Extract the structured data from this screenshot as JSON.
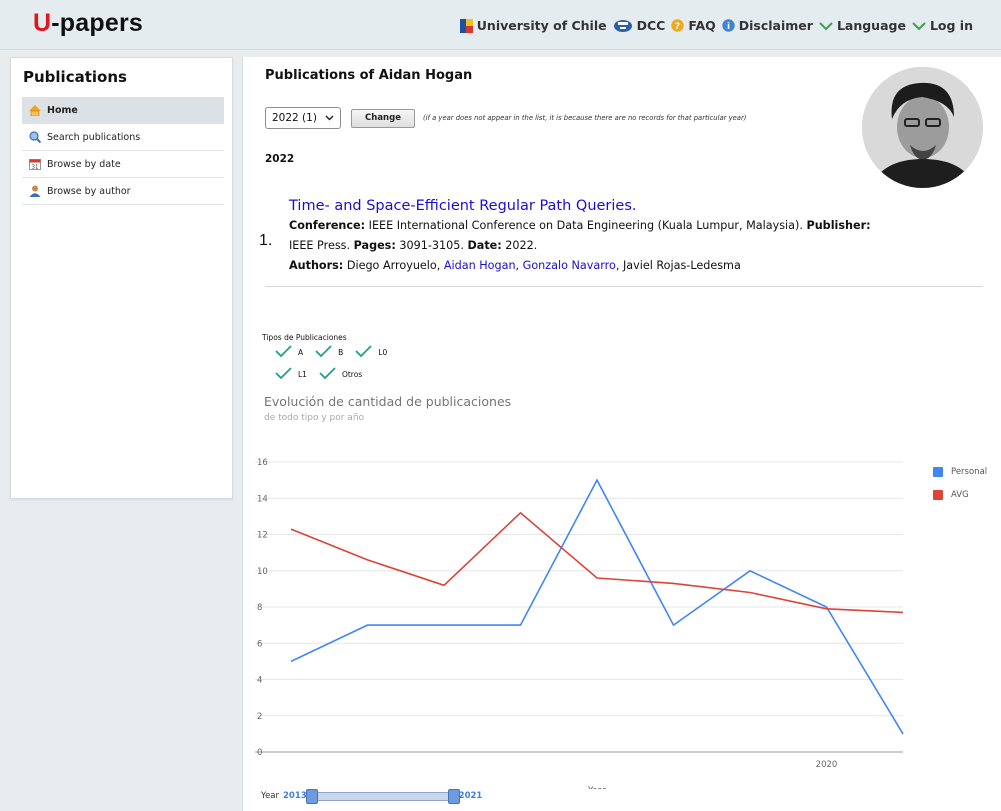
{
  "header": {
    "logo_u": "U",
    "logo_rest": "-papers",
    "nav": [
      {
        "label": "University of Chile",
        "icon": "university-icon"
      },
      {
        "label": "DCC",
        "icon": "dcc-icon"
      },
      {
        "label": "FAQ",
        "icon": "faq-icon"
      },
      {
        "label": "Disclaimer",
        "icon": "info-icon"
      },
      {
        "label": "Language",
        "icon": "chevron-down-icon"
      },
      {
        "label": "Log in",
        "icon": "chevron-down-icon"
      }
    ]
  },
  "sidebar": {
    "title": "Publications",
    "items": [
      {
        "label": "Home",
        "icon": "home-icon",
        "active": true
      },
      {
        "label": "Search publications",
        "icon": "search-icon"
      },
      {
        "label": "Browse by date",
        "icon": "calendar-icon"
      },
      {
        "label": "Browse by author",
        "icon": "user-icon"
      }
    ]
  },
  "main": {
    "title": "Publications of Aidan Hogan",
    "year_select": "2022 (1)",
    "change_label": "Change",
    "note": "(if a year does not appear in the list, it is because there are no records for that particular year)",
    "year_heading": "2022",
    "publication": {
      "number": "1.",
      "title": "Time- and Space-Efficient Regular Path Queries.",
      "conference_label": "Conference:",
      "conference": "IEEE International Conference on Data Engineering (Kuala Lumpur, Malaysia).",
      "publisher_label": "Publisher:",
      "publisher": "IEEE Press.",
      "pages_label": "Pages:",
      "pages": "3091-3105.",
      "date_label": "Date:",
      "date": "2022.",
      "authors_label": "Authors:",
      "author1": "Diego Arroyuelo,",
      "author2": "Aidan Hogan",
      "sep1": ",",
      "author3": "Gonzalo Navarro",
      "sep2": ",",
      "author4": "Javiel Rojas-Ledesma"
    },
    "types_label": "Tipos de Publicaciones",
    "types_row1": [
      "A",
      "B",
      "L0"
    ],
    "types_row2": [
      "L1",
      "Otros"
    ],
    "range_label": "Year",
    "range_start": "2013",
    "range_end": "2021"
  },
  "colors": {
    "personal": "#4285f4",
    "avg": "#db4437",
    "check": "#21a08e",
    "link": "#1a0dd6",
    "logo_red": "#e3141c"
  },
  "chart_data": {
    "type": "line",
    "title": "Evolución de cantidad de publicaciones",
    "subtitle": "de todo tipo y por año",
    "xlabel": "Year",
    "ylabel": "",
    "x": [
      2013,
      2014,
      2015,
      2016,
      2017,
      2018,
      2019,
      2020,
      2021
    ],
    "x_ticks": [
      "2020"
    ],
    "y_ticks": [
      0,
      2,
      4,
      6,
      8,
      10,
      12,
      14,
      16
    ],
    "ylim": [
      0,
      16
    ],
    "grid": true,
    "legend": "right",
    "series": [
      {
        "name": "Personal",
        "color": "#4285f4",
        "values": [
          5,
          7,
          7,
          7,
          15,
          7,
          10,
          8,
          1
        ]
      },
      {
        "name": "AVG",
        "color": "#db4437",
        "values": [
          12.3,
          10.6,
          9.2,
          13.2,
          9.6,
          9.3,
          8.8,
          7.9,
          7.7
        ]
      }
    ]
  }
}
